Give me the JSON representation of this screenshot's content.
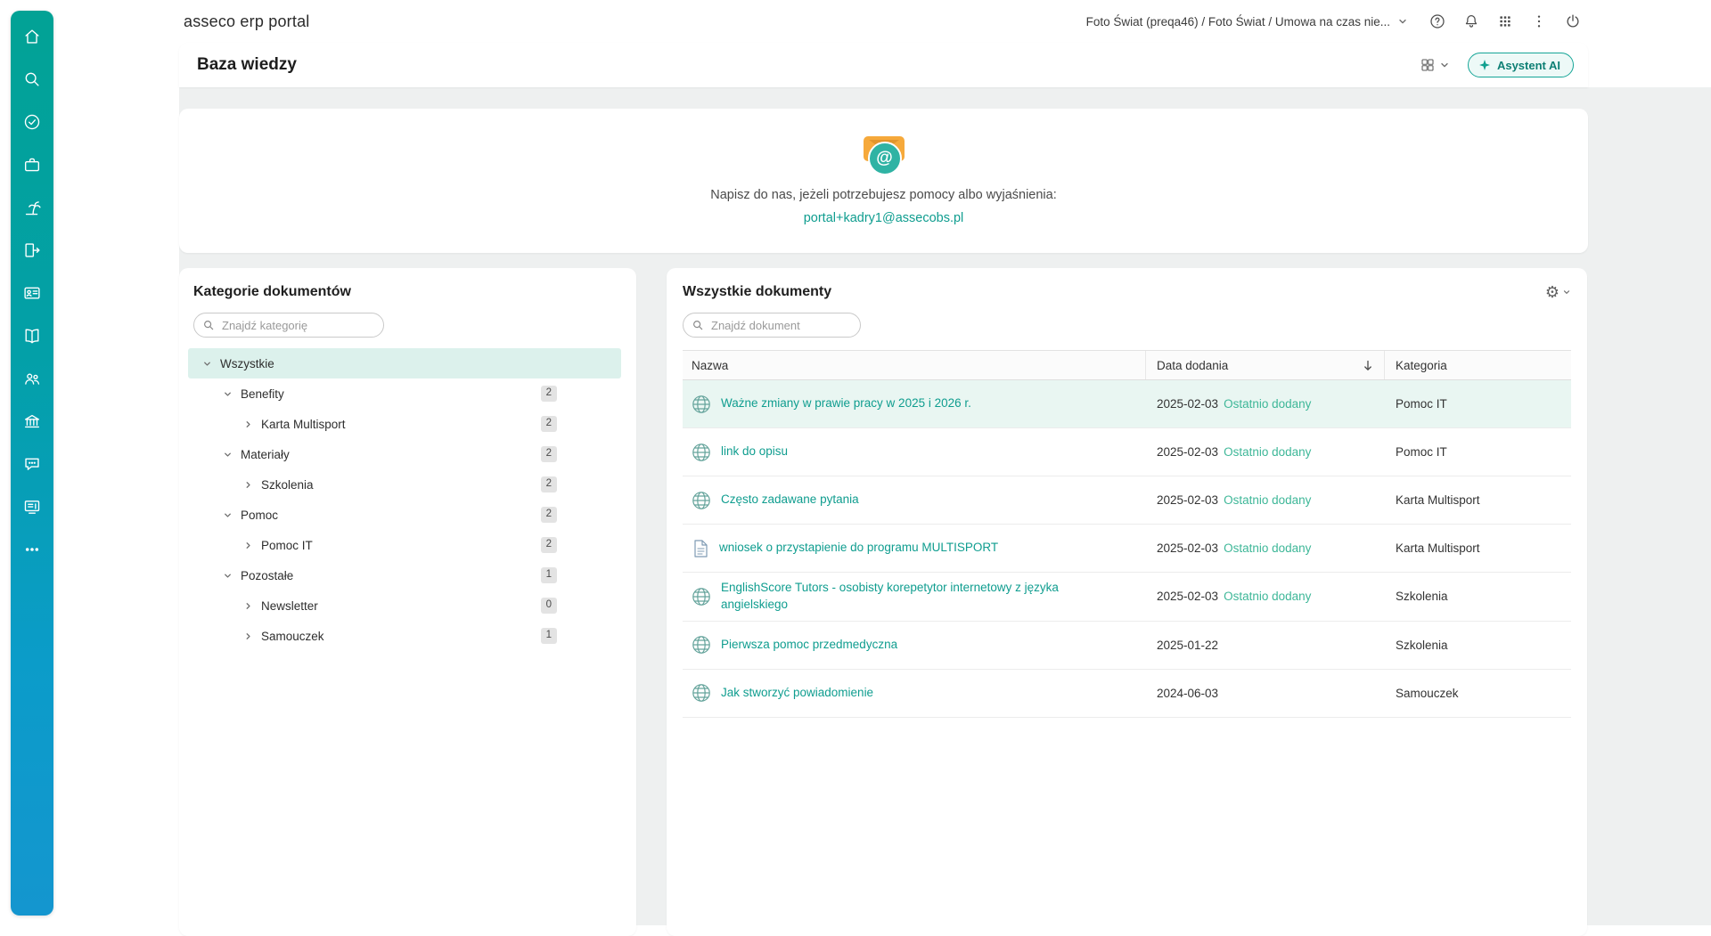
{
  "colors": {
    "accent": "#0aa396",
    "accent_light": "#dcf1ec",
    "link": "#0f9d8f",
    "recent_badge": "#3eb798",
    "sidebar_gradient_top": "#02a295",
    "sidebar_gradient_bottom": "#1496cf",
    "content_background": "#eef0f0"
  },
  "header": {
    "app_title": "asseco erp portal",
    "context": "Foto Świat (preqa46) / Foto Świat / Umowa na czas nie...",
    "icons": [
      "chevron-down-icon",
      "help-icon",
      "bell-icon",
      "apps-grid-icon",
      "kebab-menu-icon",
      "power-icon"
    ]
  },
  "page_bar": {
    "title": "Baza wiedzy",
    "assistant_label": "Asystent AI",
    "icons": [
      "layout-grid-icon",
      "chevron-down-icon",
      "sparkle-icon"
    ]
  },
  "contact_card": {
    "message": "Napisz do nas, jeżeli potrzebujesz pomocy albo wyjaśnienia:",
    "email": "portal+kadry1@assecobs.pl",
    "icon": "email-icon"
  },
  "sidebar": {
    "items": [
      {
        "icon": "home"
      },
      {
        "icon": "search"
      },
      {
        "icon": "approvals"
      },
      {
        "icon": "briefcase"
      },
      {
        "icon": "vacations"
      },
      {
        "icon": "exit"
      },
      {
        "icon": "id-card"
      },
      {
        "icon": "library"
      },
      {
        "icon": "team"
      },
      {
        "icon": "organization"
      },
      {
        "icon": "chat"
      },
      {
        "icon": "news"
      },
      {
        "icon": "more"
      }
    ]
  },
  "categories": {
    "title": "Kategorie dokumentów",
    "search_placeholder": "Znajdź kategorię",
    "tree": [
      {
        "label": "Wszystkie",
        "level": 0,
        "expanded": true,
        "selected": true
      },
      {
        "label": "Benefity",
        "level": 1,
        "expanded": true,
        "count": "2"
      },
      {
        "label": "Karta Multisport",
        "level": 2,
        "expanded": false,
        "count": "2"
      },
      {
        "label": "Materiały",
        "level": 1,
        "expanded": true,
        "count": "2"
      },
      {
        "label": "Szkolenia",
        "level": 2,
        "expanded": false,
        "count": "2"
      },
      {
        "label": "Pomoc",
        "level": 1,
        "expanded": true,
        "count": "2"
      },
      {
        "label": "Pomoc IT",
        "level": 2,
        "expanded": false,
        "count": "2"
      },
      {
        "label": "Pozostałe",
        "level": 1,
        "expanded": true,
        "count": "1"
      },
      {
        "label": "Newsletter",
        "level": 2,
        "expanded": false,
        "count": "0"
      },
      {
        "label": "Samouczek",
        "level": 2,
        "expanded": false,
        "count": "1"
      }
    ]
  },
  "documents": {
    "title": "Wszystkie dokumenty",
    "search_placeholder": "Znajdź dokument",
    "columns": {
      "name": "Nazwa",
      "date": "Data dodania",
      "category": "Kategoria"
    },
    "sort": {
      "column": "Data dodania",
      "direction": "desc"
    },
    "rows": [
      {
        "icon": "globe",
        "name": "Ważne zmiany w prawie pracy w 2025 i 2026 r.",
        "date": "2025-02-03",
        "recent": "Ostatnio dodany",
        "category": "Pomoc IT",
        "highlighted": true
      },
      {
        "icon": "globe",
        "name": "link do opisu",
        "date": "2025-02-03",
        "recent": "Ostatnio dodany",
        "category": "Pomoc IT"
      },
      {
        "icon": "globe",
        "name": "Często zadawane pytania",
        "date": "2025-02-03",
        "recent": "Ostatnio dodany",
        "category": "Karta Multisport"
      },
      {
        "icon": "file",
        "name": "wniosek o przystapienie do programu MULTISPORT",
        "date": "2025-02-03",
        "recent": "Ostatnio dodany",
        "category": "Karta Multisport"
      },
      {
        "icon": "globe",
        "name": "EnglishScore Tutors - osobisty korepetytor internetowy z języka angielskiego",
        "date": "2025-02-03",
        "recent": "Ostatnio dodany",
        "category": "Szkolenia"
      },
      {
        "icon": "globe",
        "name": "Pierwsza pomoc przedmedyczna",
        "date": "2025-01-22",
        "recent": "",
        "category": "Szkolenia"
      },
      {
        "icon": "globe",
        "name": "Jak stworzyć powiadomienie",
        "date": "2024-06-03",
        "recent": "",
        "category": "Samouczek"
      }
    ]
  }
}
